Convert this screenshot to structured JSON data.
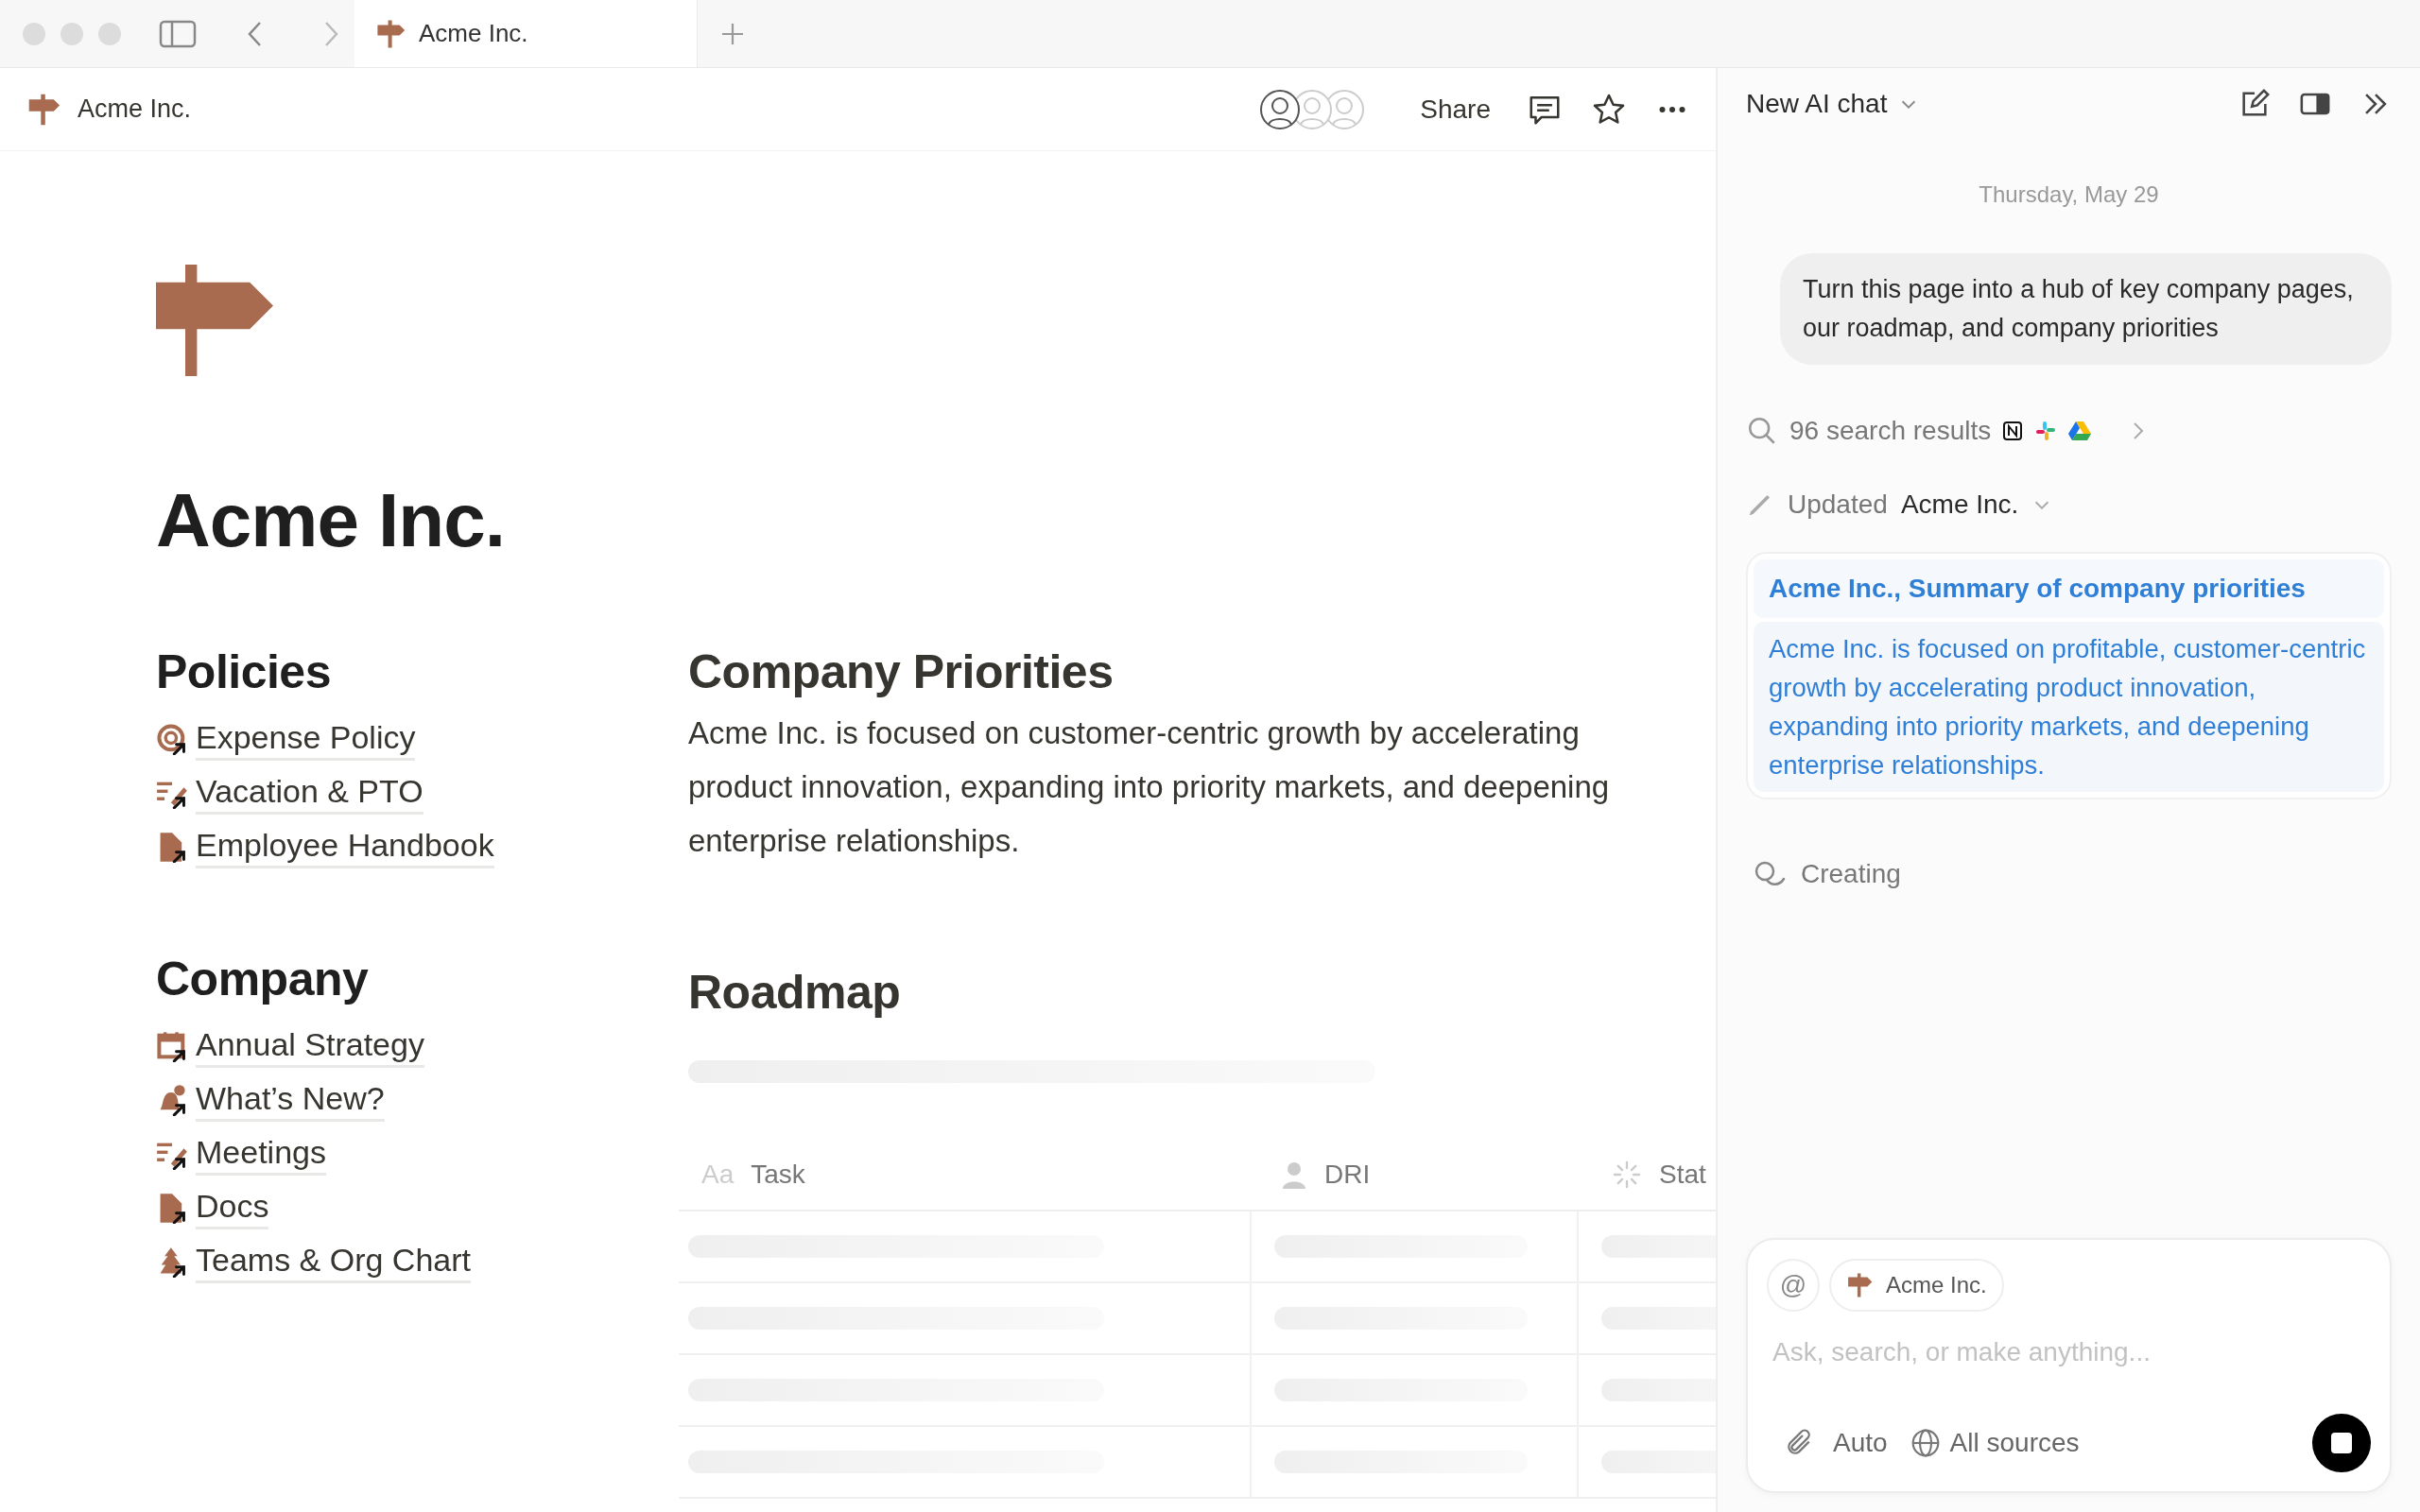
{
  "browser_tab": {
    "title": "Acme Inc.",
    "selected": true
  },
  "breadcrumb": {
    "title": "Acme Inc."
  },
  "header_actions": {
    "share": "Share"
  },
  "page": {
    "title": "Acme Inc.",
    "sections": [
      {
        "heading": "Policies",
        "links": [
          "Expense Policy",
          "Vacation & PTO",
          "Employee Handbook"
        ]
      },
      {
        "heading": "Company",
        "links": [
          "Annual Strategy",
          "What’s New?",
          "Meetings",
          "Docs",
          "Teams & Org Chart"
        ]
      }
    ],
    "priorities": {
      "heading": "Company Priorities",
      "text": "Acme Inc. is focused on customer-centric growth by accelerating product innovation, expanding into priority markets, and deepening enterprise relationships."
    },
    "roadmap": {
      "heading": "Roadmap",
      "columns": [
        {
          "label": "Task",
          "prefix": "Aa"
        },
        {
          "label": "DRI"
        },
        {
          "label": "Stat"
        }
      ]
    }
  },
  "ai_chat": {
    "title": "New AI chat",
    "date": "Thursday, May 29",
    "user_message": "Turn this page into a hub of key company pages, our roadmap, and company priorities",
    "search_results": "96 search results",
    "update": {
      "verb": "Updated",
      "target": "Acme Inc."
    },
    "summary_card": {
      "title": "Acme Inc., Summary of company priorities",
      "text": "Acme Inc. is focused on profitable, customer-centric growth by accelerating product innovation, expanding into priority markets, and deepening enterprise relationships."
    },
    "status": "Creating",
    "composer": {
      "mention": "@",
      "context_chip": "Acme Inc.",
      "placeholder": "Ask, search, or make anything...",
      "model": "Auto",
      "sources": "All sources"
    }
  }
}
